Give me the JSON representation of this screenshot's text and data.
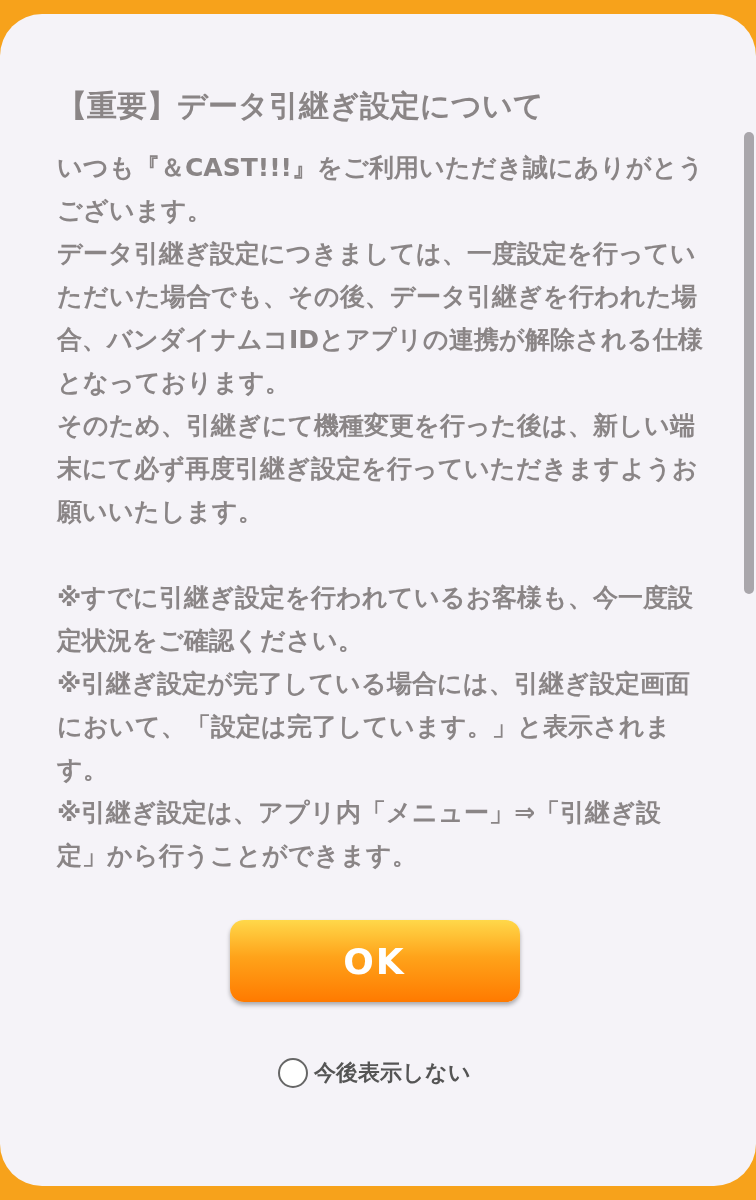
{
  "dialog": {
    "title": "【重要】データ引継ぎ設定について",
    "paragraphs": [
      "いつも『＆CAST!!!』をご利用いただき誠にありがとうございます。",
      "データ引継ぎ設定につきましては、一度設定を行っていただいた場合でも、その後、データ引継ぎを行われた場合、バンダイナムコIDとアプリの連携が解除される仕様となっております。",
      "そのため、引継ぎにて機種変更を行った後は、新しい端末にて必ず再度引継ぎ設定を行っていただきますようお願いいたします。"
    ],
    "notes": [
      "※すでに引継ぎ設定を行われているお客様も、今一度設定状況をご確認ください。",
      "※引継ぎ設定が完了している場合には、引継ぎ設定画面において、「設定は完了しています。」と表示されます。",
      "※引継ぎ設定は、アプリ内「メニュー」⇒「引継ぎ設定」から行うことができます。"
    ],
    "button": "OK",
    "checkbox": {
      "label": "今後表示しない",
      "checked": false
    }
  }
}
